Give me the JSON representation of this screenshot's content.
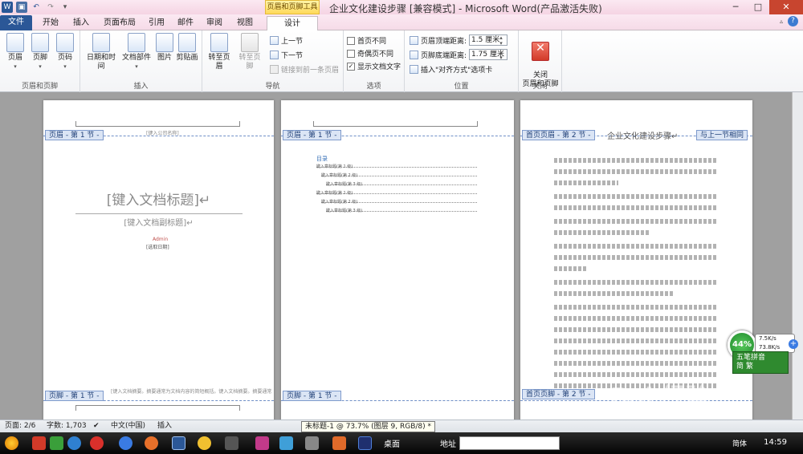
{
  "titlebar": {
    "context_group": "页眉和页脚工具",
    "title": "企业文化建设步骤 [兼容模式] - Microsoft Word(产品激活失败)",
    "help": "?"
  },
  "tabs": [
    "文件",
    "开始",
    "插入",
    "页面布局",
    "引用",
    "邮件",
    "审阅",
    "视图",
    "设计"
  ],
  "ribbon": {
    "header_footer_group": {
      "label": "页眉和页脚",
      "header": "页眉",
      "footer": "页脚",
      "page_number": "页码"
    },
    "insert_group": {
      "label": "插入",
      "datetime": "日期和时间",
      "docparts": "文档部件",
      "picture": "图片",
      "clipart": "剪贴画"
    },
    "nav_group": {
      "label": "导航",
      "goto_header": "转至页眉",
      "goto_footer": "转至页脚",
      "prev": "上一节",
      "next": "下一节",
      "link_prev": "链接到前一条页眉"
    },
    "options_group": {
      "label": "选项",
      "diff_first": "首页不同",
      "diff_oddeven": "奇偶页不同",
      "show_text": "显示文档文字",
      "show_text_checked": "✓"
    },
    "position_group": {
      "label": "位置",
      "header_dist_label": "页眉顶端距离:",
      "header_dist": "1.5 厘米",
      "footer_dist_label": "页脚底端距离:",
      "footer_dist": "1.75 厘米",
      "insert_align": "插入\"对齐方式\"选项卡"
    },
    "close_group": {
      "label": "关闭",
      "close": "关闭\n页眉和页脚"
    }
  },
  "pages": {
    "p1": {
      "header_tag": "页眉 - 第 1 节 -",
      "company_placeholder": "[键入公司名称]",
      "doc_title": "[键入文档标题]↵",
      "doc_subtitle": "[键入文档副标题]↵",
      "author": "Admin",
      "date": "[选取日期]",
      "footer_tag": "页脚 - 第 1 节 -",
      "footer_text": "[键入文档摘要。摘要通常为文档内容的简短概括。键入文档摘要。摘要通常为文档内容的简短概括。]"
    },
    "p2": {
      "header_tag": "页眉 - 第 1 节 -",
      "toc_title": "目录",
      "toc_items": [
        "键入章标题(第 1 级)",
        "键入章标题(第 2 级)",
        "键入章标题(第 3 级)",
        "键入章标题(第 1 级)",
        "键入章标题(第 2 级)",
        "键入章标题(第 3 级)"
      ],
      "footer_tag": "页脚 - 第 1 节 -"
    },
    "p3": {
      "header_tag": "首页页眉 - 第 2 节 -",
      "header_text": "企业文化建设步骤↵",
      "link_tag": "与上一节相同",
      "footer_tag": "首页页脚 - 第 2 节 -"
    }
  },
  "statusbar": {
    "page": "页面: 2/6",
    "words": "字数: 1,703",
    "lang": "中文(中国)",
    "mode": "插入",
    "tooltip": "未标题-1 @ 73.7% (图层 9, RGB/8) *"
  },
  "taskbar": {
    "desktop": "桌面",
    "address_label": "地址",
    "ime": "简体",
    "clock": "14:59"
  },
  "netwidget": {
    "percent": "44%",
    "up": "7.5K/s",
    "down": "73.8K/s",
    "ime_name": "五笔拼音",
    "ime_mode": "简 繁"
  },
  "watermark": {
    "logo": "Bai 经验",
    "url": "jingyan.baidu.com"
  },
  "colors": {
    "file_tab": "#2b5797",
    "context_tab": "#ffd95a",
    "header_tag_bg": "#dbe5f5",
    "close_red": "#d23a29"
  }
}
